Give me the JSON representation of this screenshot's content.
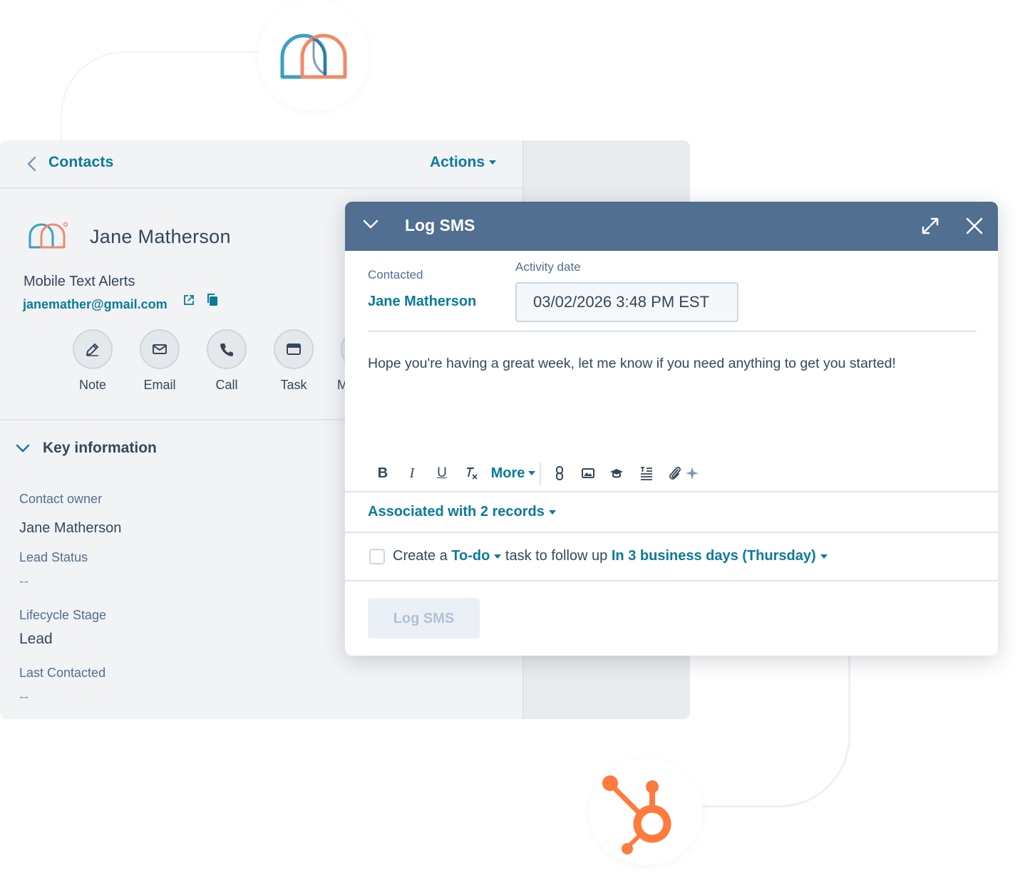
{
  "contact": {
    "header": {
      "back_label": "Contacts",
      "actions_label": "Actions"
    },
    "name": "Jane Matherson",
    "company": "Mobile Text Alerts",
    "email": "janemather@gmail.com",
    "actions": [
      {
        "label": "Note",
        "icon": "edit-icon"
      },
      {
        "label": "Email",
        "icon": "envelope-icon"
      },
      {
        "label": "Call",
        "icon": "phone-icon"
      },
      {
        "label": "Task",
        "icon": "task-icon"
      }
    ],
    "partial_action_label": "M",
    "key_information": {
      "title": "Key information",
      "properties": [
        {
          "label": "Contact owner",
          "value": "Jane Matherson"
        },
        {
          "label": "Lead Status",
          "value": "--"
        },
        {
          "label": "Lifecycle Stage",
          "value": "Lead"
        },
        {
          "label": "Last Contacted",
          "value": "--"
        }
      ]
    }
  },
  "log_sms": {
    "title": "Log SMS",
    "contacted_label": "Contacted",
    "contacted_value": "Jane Matherson",
    "activity_date_label": "Activity date",
    "activity_date_value": "03/02/2026 3:48 PM EST",
    "body": "Hope you're having a great week, let me know if you need anything to get you started!",
    "toolbar": {
      "bold": "B",
      "italic": "I",
      "underline": "U",
      "more_label": "More"
    },
    "associated_label": "Associated with 2 records",
    "task": {
      "prefix": "Create a",
      "task_type": "To-do",
      "middle": "task to follow up",
      "due": "In 3 business days (Thursday)"
    },
    "submit_label": "Log SMS"
  },
  "colors": {
    "brand_teal": "#0b7a9a",
    "modal_header": "#516f90",
    "hubspot_orange": "#ff7a3d",
    "logo_blue": "#3b9ec4",
    "logo_orange": "#f08a6a"
  }
}
